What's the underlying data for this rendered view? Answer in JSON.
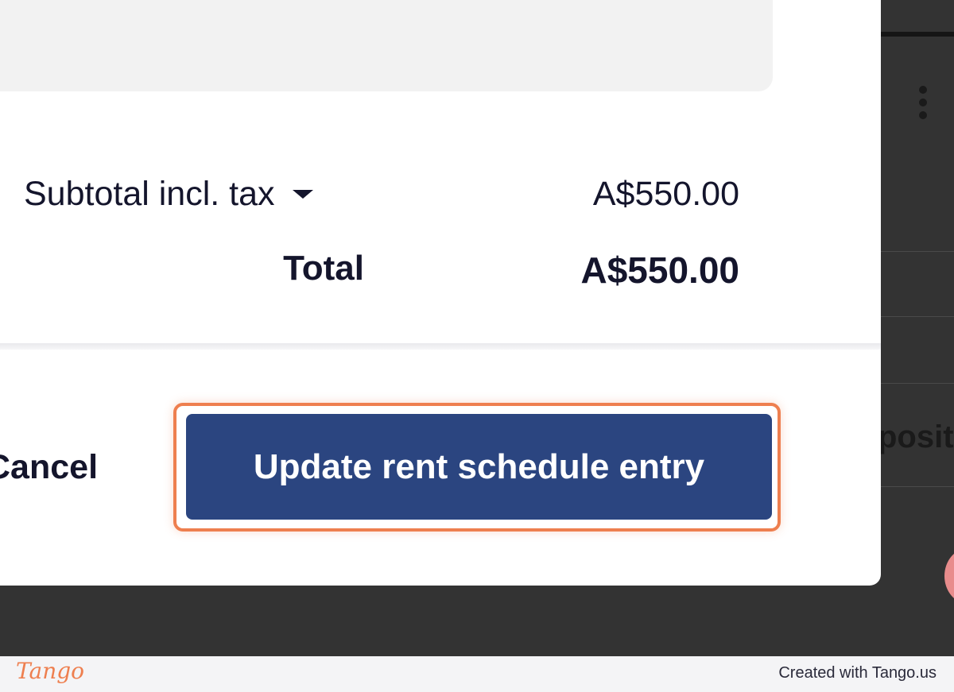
{
  "summary": {
    "subtotal_label": "Subtotal incl. tax",
    "subtotal_value": "A$550.00",
    "total_label": "Total",
    "total_value": "A$550.00"
  },
  "actions": {
    "cancel_label": "Cancel",
    "primary_label": "Update rent schedule entry"
  },
  "background": {
    "partial_text": "posit",
    "menu_icon": "kebab-menu-icon"
  },
  "footer": {
    "logo_text": "Tango",
    "credit_text": "Created with Tango.us"
  },
  "colors": {
    "primary_button": "#2b4580",
    "highlight_outline": "#ee7f4f",
    "text": "#14152c",
    "backdrop": "#333333"
  }
}
